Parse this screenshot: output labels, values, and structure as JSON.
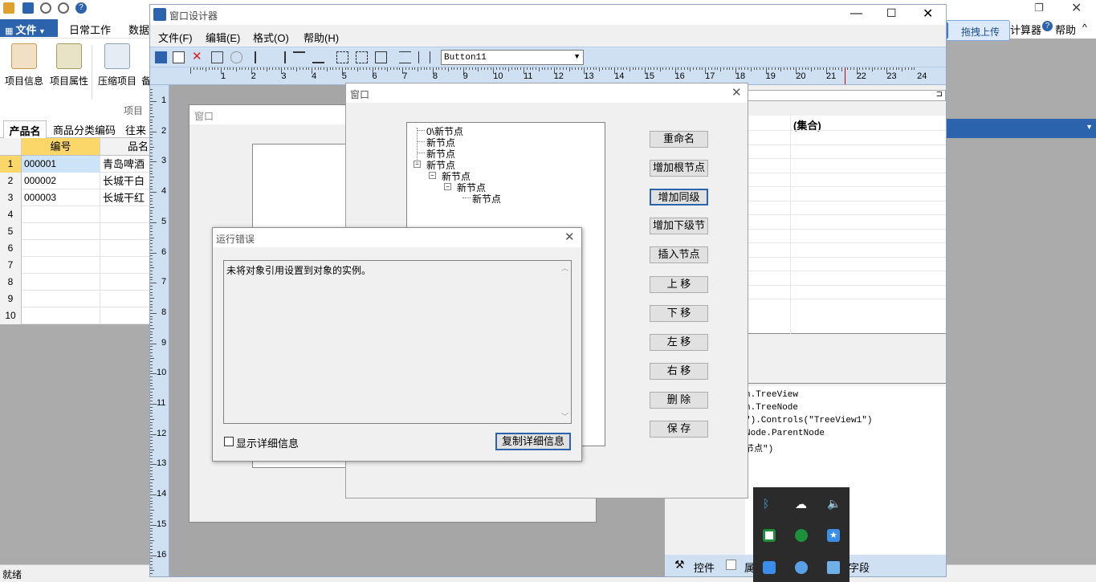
{
  "app": {
    "menu": {
      "file": "文件",
      "tabs": [
        "日常工作",
        "数据"
      ]
    },
    "ribbon": {
      "buttons": [
        "项目信息",
        "项目属性",
        "压缩项目",
        "备"
      ],
      "group_label": "项目"
    },
    "sheet_tabs": [
      "产品名",
      "商品分类编码",
      "往来"
    ],
    "grid": {
      "headers": [
        "编号",
        "品名"
      ],
      "rows": [
        {
          "n": "1",
          "code": "000001",
          "name": "青岛啤酒"
        },
        {
          "n": "2",
          "code": "000002",
          "name": "长城干白"
        },
        {
          "n": "3",
          "code": "000003",
          "name": "长城干红"
        },
        {
          "n": "4",
          "code": "",
          "name": ""
        },
        {
          "n": "5",
          "code": "",
          "name": ""
        },
        {
          "n": "6",
          "code": "",
          "name": ""
        },
        {
          "n": "7",
          "code": "",
          "name": ""
        },
        {
          "n": "8",
          "code": "",
          "name": ""
        },
        {
          "n": "9",
          "code": "",
          "name": ""
        },
        {
          "n": "10",
          "code": "",
          "name": ""
        }
      ]
    },
    "right_top": {
      "calc": "计算器",
      "help": "帮助",
      "upload": "拖拽上传"
    },
    "status": "就绪"
  },
  "designer": {
    "title": "窗口设计器",
    "menu": [
      "文件(F)",
      "编辑(E)",
      "格式(O)",
      "帮助(H)"
    ],
    "combo_value": "Button11",
    "ruler_h": [
      "1",
      "2",
      "3",
      "4",
      "5",
      "6",
      "7",
      "8",
      "9",
      "10",
      "11",
      "12",
      "13",
      "14",
      "15",
      "16",
      "17",
      "18",
      "19",
      "20",
      "21",
      "22",
      "23",
      "24"
    ],
    "ruler_v": [
      "1",
      "2",
      "3",
      "4",
      "5",
      "6",
      "7",
      "8",
      "9",
      "10",
      "11",
      "12",
      "13",
      "14",
      "15",
      "16"
    ],
    "design_form_title": "窗口",
    "props": {
      "header": "(集合)",
      "code_lines": [
        "n.TreeView",
        "n.TreeNode",
        "\").Controls(\"TreeView1\")",
        "Node.ParentNode",
        "节点\")"
      ],
      "bottom_tabs": [
        "控件",
        "属",
        "字段"
      ]
    }
  },
  "tree_window": {
    "title": "窗口",
    "nodes": [
      {
        "label": "0\\新节点",
        "level": 0
      },
      {
        "label": "新节点",
        "level": 0
      },
      {
        "label": "新节点",
        "level": 0
      },
      {
        "label": "新节点",
        "level": 0
      },
      {
        "label": "新节点",
        "level": 1
      },
      {
        "label": "新节点",
        "level": 2
      },
      {
        "label": "新节点",
        "level": 3
      }
    ],
    "buttons": [
      "重命名",
      "增加根节点",
      "增加同级",
      "增加下级节",
      "插入节点",
      "上 移",
      "下 移",
      "左 移",
      "右 移",
      "删 除",
      "保 存"
    ]
  },
  "error_dialog": {
    "title": "运行错误",
    "message": "未将对象引用设置到对象的实例。",
    "show_details": "显示详细信息",
    "copy_button": "复制详细信息"
  },
  "colors": {
    "accent": "#2b63ad",
    "toolbar": "#cfe0f3",
    "selected_row": "#cde3f7",
    "col_header": "#fbd76a"
  }
}
